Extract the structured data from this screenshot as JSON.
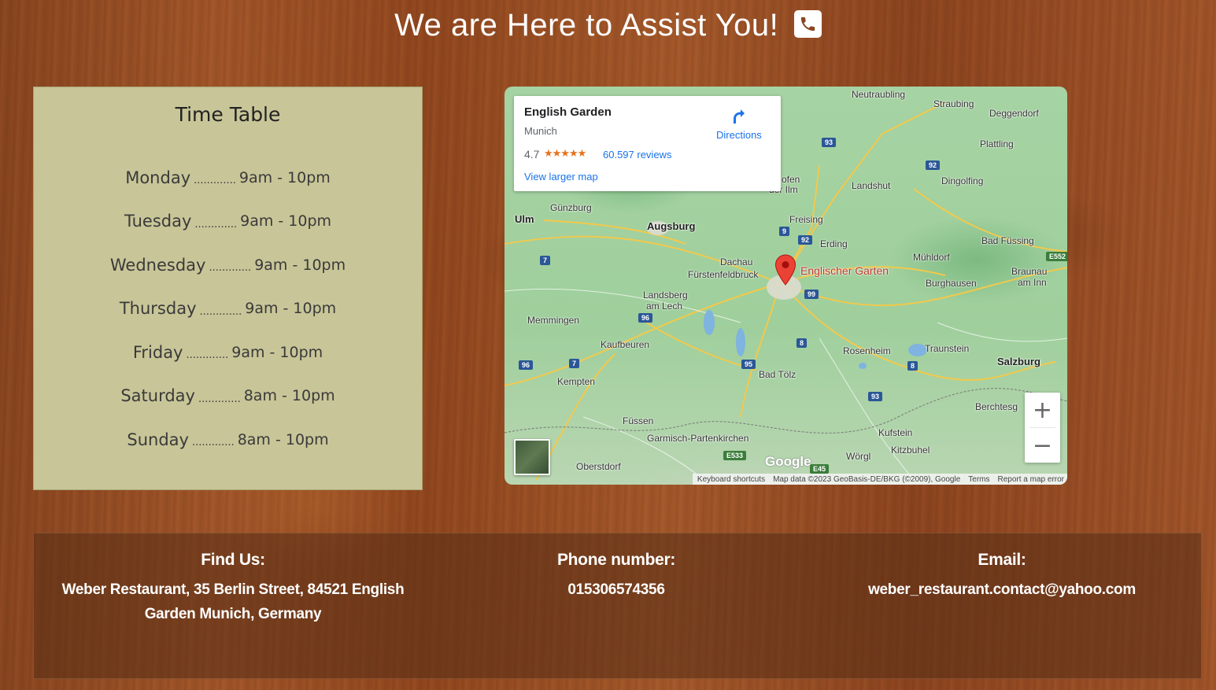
{
  "header": {
    "title": "We are Here to Assist You!",
    "icon": "phone-icon"
  },
  "timetable": {
    "title": "Time Table",
    "dots": ".............",
    "rows": [
      {
        "day": "Monday",
        "hours": "9am - 10pm"
      },
      {
        "day": "Tuesday",
        "hours": "9am - 10pm"
      },
      {
        "day": "Wednesday",
        "hours": "9am - 10pm"
      },
      {
        "day": "Thursday",
        "hours": "9am - 10pm"
      },
      {
        "day": "Friday",
        "hours": "9am - 10pm"
      },
      {
        "day": "Saturday",
        "hours": "8am - 10pm"
      },
      {
        "day": "Sunday",
        "hours": "8am - 10pm"
      }
    ]
  },
  "map": {
    "place_name": "English Garden",
    "place_city": "Munich",
    "rating": "4.7",
    "stars": "★★★★★",
    "reviews": "60.597 reviews",
    "view_larger": "View larger map",
    "directions": "Directions",
    "zoom_in": "+",
    "zoom_out": "−",
    "pin_label": "Englischer Garten",
    "google": "Google",
    "attribution": {
      "shortcuts": "Keyboard shortcuts",
      "data": "Map data ©2023 GeoBasis-DE/BKG (©2009), Google",
      "terms": "Terms",
      "report": "Report a map error"
    },
    "places": {
      "neutraubling": "Neutraubling",
      "straubing": "Straubing",
      "deggendorf": "Deggendorf",
      "plattling": "Plattling",
      "landshut": "Landshut",
      "dingolfing": "Dingolfing",
      "hofen": "ofen",
      "der_ilm": "der Ilm",
      "ulm": "Ulm",
      "gunzburg": "Günzburg",
      "augsburg": "Augsburg",
      "freising": "Freising",
      "erding": "Erding",
      "bad_fussing": "Bad Füssing",
      "dachau": "Dachau",
      "furstenfeldbruck": "Fürstenfeldbruck",
      "muhldorf": "Mühldorf",
      "braunau": "Braunau",
      "am_inn": "am Inn",
      "burghausen": "Burghausen",
      "landsberg": "Landsberg",
      "am_lech": "am Lech",
      "memmingen": "Memmingen",
      "kaufbeuren": "Kaufbeuren",
      "rosenheim": "Rosenheim",
      "traunstein": "Traunstein",
      "salzburg": "Salzburg",
      "kempten": "Kempten",
      "bad_tolz": "Bad Tölz",
      "berchtesg": "Berchtesg",
      "fussen": "Füssen",
      "garmisch": "Garmisch-Partenkirchen",
      "kufstein": "Kufstein",
      "kitzbuhel": "Kitzbuhel",
      "oberstdorf": "Oberstdorf",
      "worgl": "Wörgl"
    },
    "routes": {
      "r93a": "93",
      "r92": "92",
      "r9": "9",
      "r92b": "92",
      "r7a": "7",
      "r99": "99",
      "r96": "96",
      "r8a": "8",
      "r96b": "96",
      "r7b": "7",
      "r95": "95",
      "r8b": "8",
      "r93b": "93",
      "e533": "E533",
      "e45": "E45",
      "e552": "E552"
    }
  },
  "footer": {
    "find_us": {
      "title": "Find Us:",
      "line1": "Weber Restaurant, 35 Berlin Street, 84521 English",
      "line2": "Garden Munich, Germany"
    },
    "phone": {
      "title": "Phone number:",
      "value": "015306574356"
    },
    "email": {
      "title": "Email:",
      "value": "weber_restaurant.contact@yahoo.com"
    }
  },
  "colors": {
    "timetable_bg": "#c8c598",
    "link_blue": "#1a73e8",
    "pin_red": "#ea4335"
  }
}
